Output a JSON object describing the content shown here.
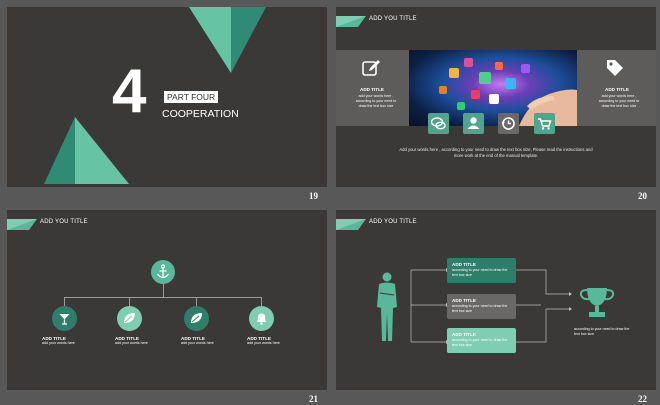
{
  "colors": {
    "accent": "#59b79a",
    "accent_dark": "#2f7e6a",
    "accent_light": "#7fcdb3",
    "slide_bg": "#3a3937",
    "gray_panel": "#5e5c5a"
  },
  "slides": [
    {
      "number": "19",
      "big_number": "4",
      "part_label": "PART FOUR",
      "part_title": "COOPERATION"
    },
    {
      "number": "20",
      "header_title": "ADD YOU TITLE",
      "left_card": {
        "icon": "edit-icon",
        "title": "ADD TITLE",
        "body": "add your words here , according to your need to draw the text box size"
      },
      "right_card": {
        "icon": "tag-icon",
        "title": "ADD TITLE",
        "body": "add your words here , according to your need to draw the text box size"
      },
      "icon_buttons": [
        "chat-icon",
        "user-icon",
        "history-icon",
        "cart-icon"
      ],
      "footer_line1": "Add your words here , according to your need to draw the text box size, Please read the instructions and",
      "footer_line2": "more work at the end of the manual template."
    },
    {
      "number": "21",
      "header_title": "ADD YOU TITLE",
      "root_icon": "anchor-icon",
      "nodes": [
        {
          "icon": "cocktail-icon",
          "title": "ADD TITLE",
          "body": "add your words here"
        },
        {
          "icon": "leaf-icon",
          "title": "ADD TITLE",
          "body": "add your words here"
        },
        {
          "icon": "leaf-icon",
          "title": "ADD TITLE",
          "body": "add your words here"
        },
        {
          "icon": "bell-icon",
          "title": "ADD TITLE",
          "body": "add your words here"
        }
      ]
    },
    {
      "number": "22",
      "header_title": "ADD YOU TITLE",
      "boxes": [
        {
          "title": "ADD TITLE",
          "body": "according to your need to draw the text box size"
        },
        {
          "title": "ADD TITLE",
          "body": "according to your need to draw the text box size"
        },
        {
          "title": "ADD TITLE",
          "body": "according to your need to draw the text box size"
        }
      ],
      "trophy_caption": "according to your need to draw the text box size"
    }
  ]
}
